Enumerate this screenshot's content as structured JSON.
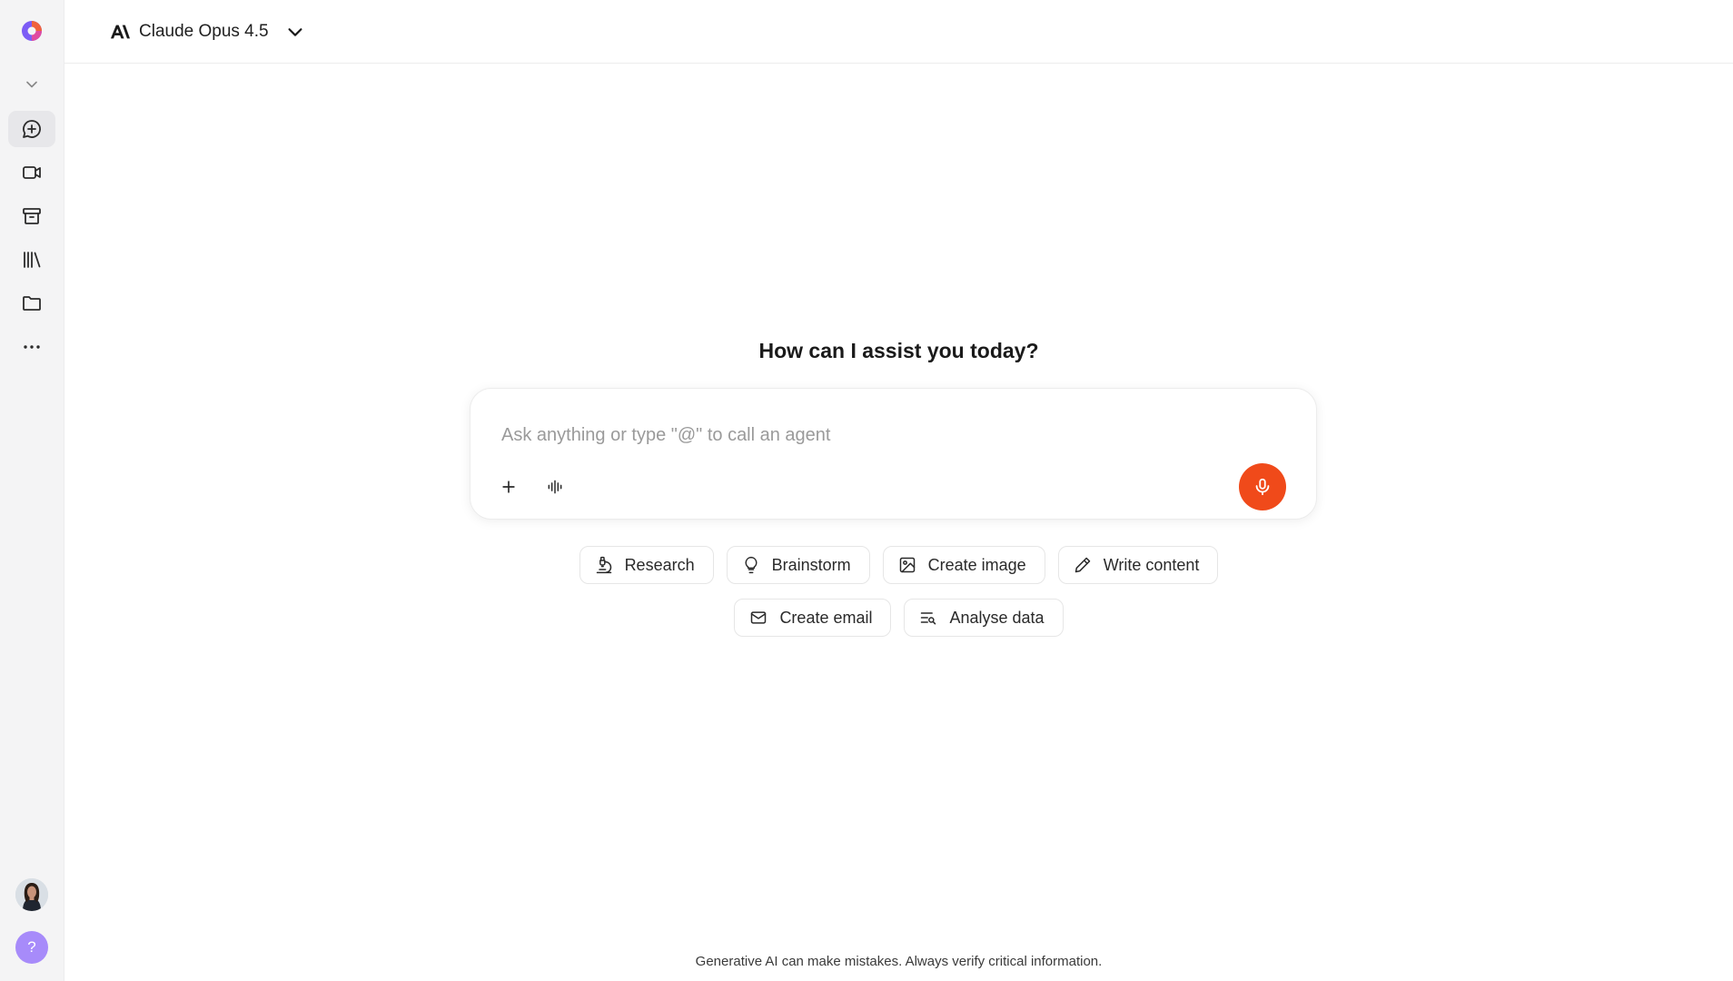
{
  "header": {
    "model_name": "Claude Opus 4.5",
    "model_icon": "anthropic-logo"
  },
  "sidebar": {
    "logo_icon": "app-logo",
    "items": [
      {
        "name": "collapse",
        "icon": "chevron-down-icon"
      },
      {
        "name": "new-chat",
        "icon": "chat-plus-icon",
        "active": true
      },
      {
        "name": "video",
        "icon": "video-icon"
      },
      {
        "name": "archive",
        "icon": "archive-box-icon"
      },
      {
        "name": "library",
        "icon": "library-icon"
      },
      {
        "name": "folder",
        "icon": "folder-icon"
      },
      {
        "name": "more",
        "icon": "more-horizontal-icon"
      }
    ],
    "help_label": "?"
  },
  "main": {
    "greeting": "How can I assist you today?",
    "composer": {
      "placeholder": "Ask anything or type \"@\" to call an agent",
      "value": ""
    },
    "chips_row1": [
      {
        "label": "Research",
        "icon": "microscope-icon"
      },
      {
        "label": "Brainstorm",
        "icon": "lightbulb-icon"
      },
      {
        "label": "Create image",
        "icon": "image-icon"
      },
      {
        "label": "Write content",
        "icon": "pen-icon"
      }
    ],
    "chips_row2": [
      {
        "label": "Create email",
        "icon": "mail-icon"
      },
      {
        "label": "Analyse data",
        "icon": "data-search-icon"
      }
    ],
    "disclaimer": "Generative AI can make mistakes. Always verify critical information."
  },
  "colors": {
    "accent_mic": "#f04a1a",
    "help_button": "#a78bfa",
    "sidebar_bg": "#f4f4f5"
  }
}
